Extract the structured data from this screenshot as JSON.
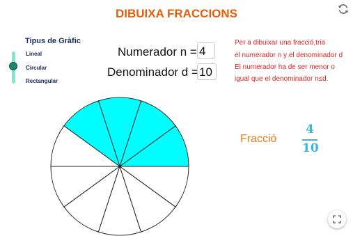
{
  "title": "DIBUIXA FRACCIONS",
  "graph_type": {
    "heading": "Tipus de Gràfic",
    "options": [
      "Lineal",
      "Circular",
      "Rectangular"
    ],
    "selected": "Circular"
  },
  "numerator": {
    "label": "Numerador  n =",
    "value": "4"
  },
  "denominator": {
    "label": "Denominador  d =",
    "value": "10"
  },
  "instructions": [
    "Per a dibuixar una fracció,tria",
    "el numerador n y el denominador d",
    "El numerador ha de ser menor o",
    "igual que el denominador n≤d."
  ],
  "fraction": {
    "label": "Fracció",
    "numerator": "4",
    "denominator": "10"
  },
  "chart_data": {
    "type": "pie",
    "slices_total": 10,
    "slices_filled": 4,
    "filled_color": "#00ffff",
    "empty_color": "#ffffff"
  },
  "colors": {
    "title": "#e35d0c",
    "accent": "#1b8a72",
    "instructions": "#e82020",
    "fraction": "#38b8d6"
  },
  "icons": {
    "refresh": "refresh-icon",
    "fullscreen": "fullscreen-icon"
  }
}
